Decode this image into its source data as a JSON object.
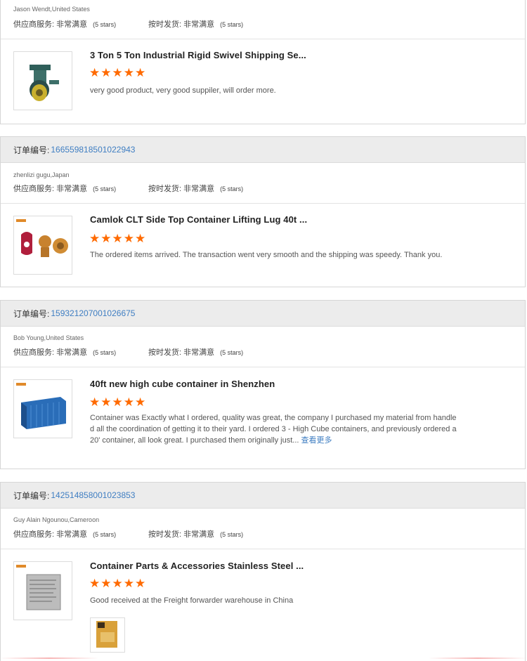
{
  "colors": {
    "star": "#ff6a00",
    "link": "#3f7ec2",
    "order_bar_bg": "#ececec"
  },
  "labels": {
    "order_prefix": "订单编号:",
    "supplier_service": "供应商服务: 非常满意",
    "on_time": "按时发货: 非常满意",
    "stars_suffix": "(5 stars)"
  },
  "reviews": [
    {
      "buyer": "Jason Wendt,United States",
      "product_title": "3 Ton 5 Ton Industrial Rigid Swivel Shipping Se...",
      "rating": 5,
      "text": "very good product, very good suppiler, will order more.",
      "thumbnail": "caster-wheel-image"
    },
    {
      "order_number": "166559818501022943",
      "buyer": "zhenlizi gugu,Japan",
      "product_title": "Camlok CLT Side Top Container Lifting Lug 40t ...",
      "rating": 5,
      "text": "The ordered items arrived. The transaction went very smooth and the shipping was speedy. Thank you.",
      "thumbnail": "lifting-lug-image"
    },
    {
      "order_number": "159321207001026675",
      "buyer": "Bob Young,United States",
      "product_title": "40ft new high cube container in Shenzhen",
      "rating": 5,
      "text_lines": [
        "Container was Exactly what I ordered, quality was great, the company I purchased my material from handle",
        "d all the coordination of getting it to their yard. I ordered 3 - High Cube containers, and previously ordered a",
        "20' container, all look great. I purchased them originally just..."
      ],
      "more_link": "查看更多",
      "thumbnail": "shipping-container-image"
    },
    {
      "order_number": "142514858001023853",
      "buyer": "Guy Alain Ngounou,Cameroon",
      "product_title": "Container Parts & Accessories Stainless Steel ...",
      "rating": 5,
      "text": "Good received at the Freight forwarder warehouse in China",
      "thumbnail": "data-plate-image",
      "attachment": "buyer-photo-image"
    }
  ]
}
